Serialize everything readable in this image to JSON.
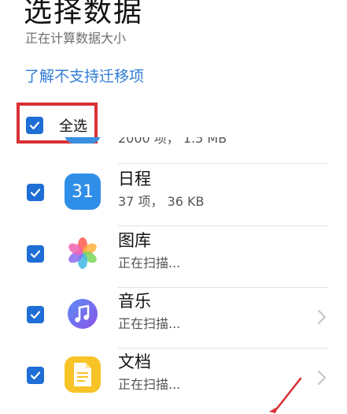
{
  "header": {
    "title": "选择数据",
    "subtitle": "正在计算数据大小",
    "unsupported_link": "了解不支持迁移项"
  },
  "select_all": {
    "label": "全选",
    "checked": true
  },
  "partial_item": {
    "subtitle": "2000 项， 1.5 MB"
  },
  "items": [
    {
      "name": "日程",
      "subtitle": "37 项， 36 KB",
      "icon": "calendar-icon",
      "icon_text": "31",
      "checked": true,
      "has_chevron": false
    },
    {
      "name": "图库",
      "subtitle": "正在扫描...",
      "icon": "gallery-icon",
      "checked": true,
      "has_chevron": false
    },
    {
      "name": "音乐",
      "subtitle": "正在扫描...",
      "icon": "music-icon",
      "checked": true,
      "has_chevron": true
    },
    {
      "name": "文档",
      "subtitle": "正在扫描...",
      "icon": "document-icon",
      "checked": true,
      "has_chevron": true
    }
  ],
  "colors": {
    "accent": "#1e6ed5",
    "link": "#2f7dd6",
    "highlight_box": "#d93035"
  }
}
